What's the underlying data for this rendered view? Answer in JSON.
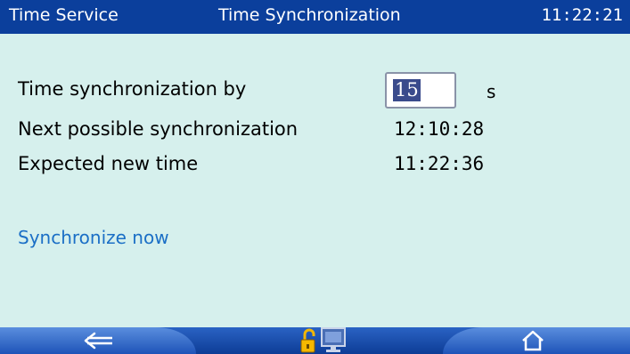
{
  "header": {
    "service_label": "Time Service",
    "title": "Time Synchronization",
    "clock": "11:22:21"
  },
  "form": {
    "sync_by_label": "Time synchronization by",
    "sync_by_value": "15",
    "sync_by_unit": "s",
    "next_sync_label": "Next possible synchronization",
    "next_sync_value": "12:10:28",
    "expected_label": "Expected new time",
    "expected_value": "11:22:36"
  },
  "actions": {
    "sync_now_label": "Synchronize now"
  },
  "footer": {
    "back_icon": "back-arrow-icon",
    "lock_icon": "unlocked-padlock-icon",
    "monitor_icon": "monitor-icon",
    "home_icon": "home-icon"
  },
  "colors": {
    "background": "#d6f0ed",
    "header": "#0b3f9c",
    "link": "#1b6fc6",
    "selection": "#3a4b8c"
  }
}
